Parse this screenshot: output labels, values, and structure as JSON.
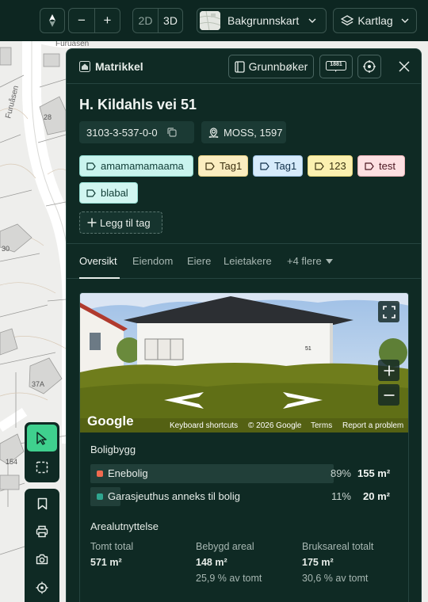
{
  "map": {
    "street_labels": [
      "Furuåsen",
      "Furuåsen"
    ],
    "house_numbers": [
      "28",
      "30",
      "37A",
      "154"
    ]
  },
  "toolbar": {
    "compass_icon": "compass-icon",
    "zoom_out_label": "−",
    "zoom_in_label": "+",
    "view_2d": "2D",
    "view_3d": "3D",
    "active_view": "3D",
    "basemap_label": "Bakgrunnskart",
    "layers_label": "Kartlag"
  },
  "panel": {
    "header_title": "Matrikkel",
    "grunnboker_label": "Grunnbøker",
    "badge_1881": "1881",
    "address": "H. Kildahls vei 51",
    "matrikkel_id": "3103-3-537-0-0",
    "municipality": "MOSS, 1597",
    "tags": [
      {
        "label": "amamamamaama",
        "bg": "#c9f4ee",
        "border": "#8fd8cd",
        "color": "#0f3b34"
      },
      {
        "label": "Tag1",
        "bg": "#fbedc0",
        "border": "#e4cf86",
        "color": "#3a2e0e"
      },
      {
        "label": "Tag1",
        "bg": "#d6ebfb",
        "border": "#9dc3e3",
        "color": "#10304a"
      },
      {
        "label": "123",
        "bg": "#fbf0b0",
        "border": "#e4d57a",
        "color": "#3a3210"
      },
      {
        "label": "test",
        "bg": "#fde0e2",
        "border": "#eab0b5",
        "color": "#4a1520"
      },
      {
        "label": "blabal",
        "bg": "#d1f6f1",
        "border": "#93dbd0",
        "color": "#0f3b34"
      }
    ],
    "add_tag_label": "Legg til tag",
    "tabs": [
      "Oversikt",
      "Eiendom",
      "Eiere",
      "Leietakere",
      "+4 flere"
    ],
    "active_tab": "Oversikt"
  },
  "streetview": {
    "google_logo": "Google",
    "house_number": "51",
    "footer": [
      "Keyboard shortcuts",
      "© 2026 Google",
      "Terms",
      "Report a problem"
    ]
  },
  "boligbygg": {
    "heading": "Boligbygg",
    "rows": [
      {
        "label": "Enebolig",
        "percent": "89%",
        "area": "155 m²",
        "fraction": 0.89,
        "color": "#f06a4f"
      },
      {
        "label": "Garasjeuthus anneks til bolig",
        "percent": "11%",
        "area": "20 m²",
        "fraction": 0.11,
        "color": "#2fa58f"
      }
    ]
  },
  "arealutnyttelse": {
    "heading": "Arealutnyttelse",
    "stats": [
      {
        "label": "Tomt total",
        "value": "571 m²",
        "sub": ""
      },
      {
        "label": "Bebygd areal",
        "value": "148 m²",
        "sub": "25,9 % av tomt"
      },
      {
        "label": "Bruksareal totalt",
        "value": "175 m²",
        "sub": "30,6 % av tomt"
      }
    ]
  }
}
